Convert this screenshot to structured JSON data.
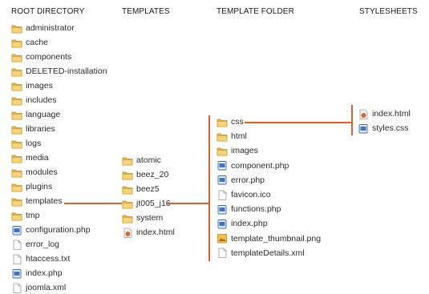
{
  "headers": {
    "root": "ROOT DIRECTORY",
    "templates": "TEMPLATES",
    "template_folder": "TEMPLATE FOLDER",
    "stylesheets": "STYLESHEETS"
  },
  "root_items": [
    {
      "label": "administrator",
      "icon": "folder-icon"
    },
    {
      "label": "cache",
      "icon": "folder-icon"
    },
    {
      "label": "components",
      "icon": "folder-icon"
    },
    {
      "label": "DELETED-installation",
      "icon": "folder-icon"
    },
    {
      "label": "images",
      "icon": "folder-icon"
    },
    {
      "label": "includes",
      "icon": "folder-icon"
    },
    {
      "label": "language",
      "icon": "folder-icon"
    },
    {
      "label": "libraries",
      "icon": "folder-icon"
    },
    {
      "label": "logs",
      "icon": "folder-icon"
    },
    {
      "label": "media",
      "icon": "folder-icon"
    },
    {
      "label": "modules",
      "icon": "folder-icon"
    },
    {
      "label": "plugins",
      "icon": "folder-icon"
    },
    {
      "label": "templates",
      "icon": "folder-icon"
    },
    {
      "label": "tmp",
      "icon": "folder-icon"
    },
    {
      "label": "configuration.php",
      "icon": "php-file-icon"
    },
    {
      "label": "error_log",
      "icon": "blank-file-icon"
    },
    {
      "label": "htaccess.txt",
      "icon": "blank-file-icon"
    },
    {
      "label": "index.php",
      "icon": "php-file-icon"
    },
    {
      "label": "joomla.xml",
      "icon": "blank-file-icon"
    }
  ],
  "template_items": [
    {
      "label": "atomic",
      "icon": "folder-icon"
    },
    {
      "label": "beez_20",
      "icon": "folder-icon"
    },
    {
      "label": "beez5",
      "icon": "folder-icon"
    },
    {
      "label": "jt005_j16",
      "icon": "folder-icon"
    },
    {
      "label": "system",
      "icon": "folder-icon"
    },
    {
      "label": "index.html",
      "icon": "html-file-icon"
    }
  ],
  "template_folder_items": [
    {
      "label": "css",
      "icon": "folder-icon"
    },
    {
      "label": "html",
      "icon": "folder-icon"
    },
    {
      "label": "images",
      "icon": "folder-icon"
    },
    {
      "label": "component.php",
      "icon": "php-file-icon"
    },
    {
      "label": "error.php",
      "icon": "php-file-icon"
    },
    {
      "label": "favicon.ico",
      "icon": "blank-file-icon"
    },
    {
      "label": "functions.php",
      "icon": "php-file-icon"
    },
    {
      "label": "index.php",
      "icon": "php-file-icon"
    },
    {
      "label": "template_thumbnail.png",
      "icon": "image-file-icon"
    },
    {
      "label": "templateDetails.xml",
      "icon": "blank-file-icon"
    }
  ],
  "stylesheet_items": [
    {
      "label": "index.html",
      "icon": "html-file-icon"
    },
    {
      "label": "styles.css",
      "icon": "css-file-icon"
    }
  ],
  "connector_color": "#d9622b"
}
